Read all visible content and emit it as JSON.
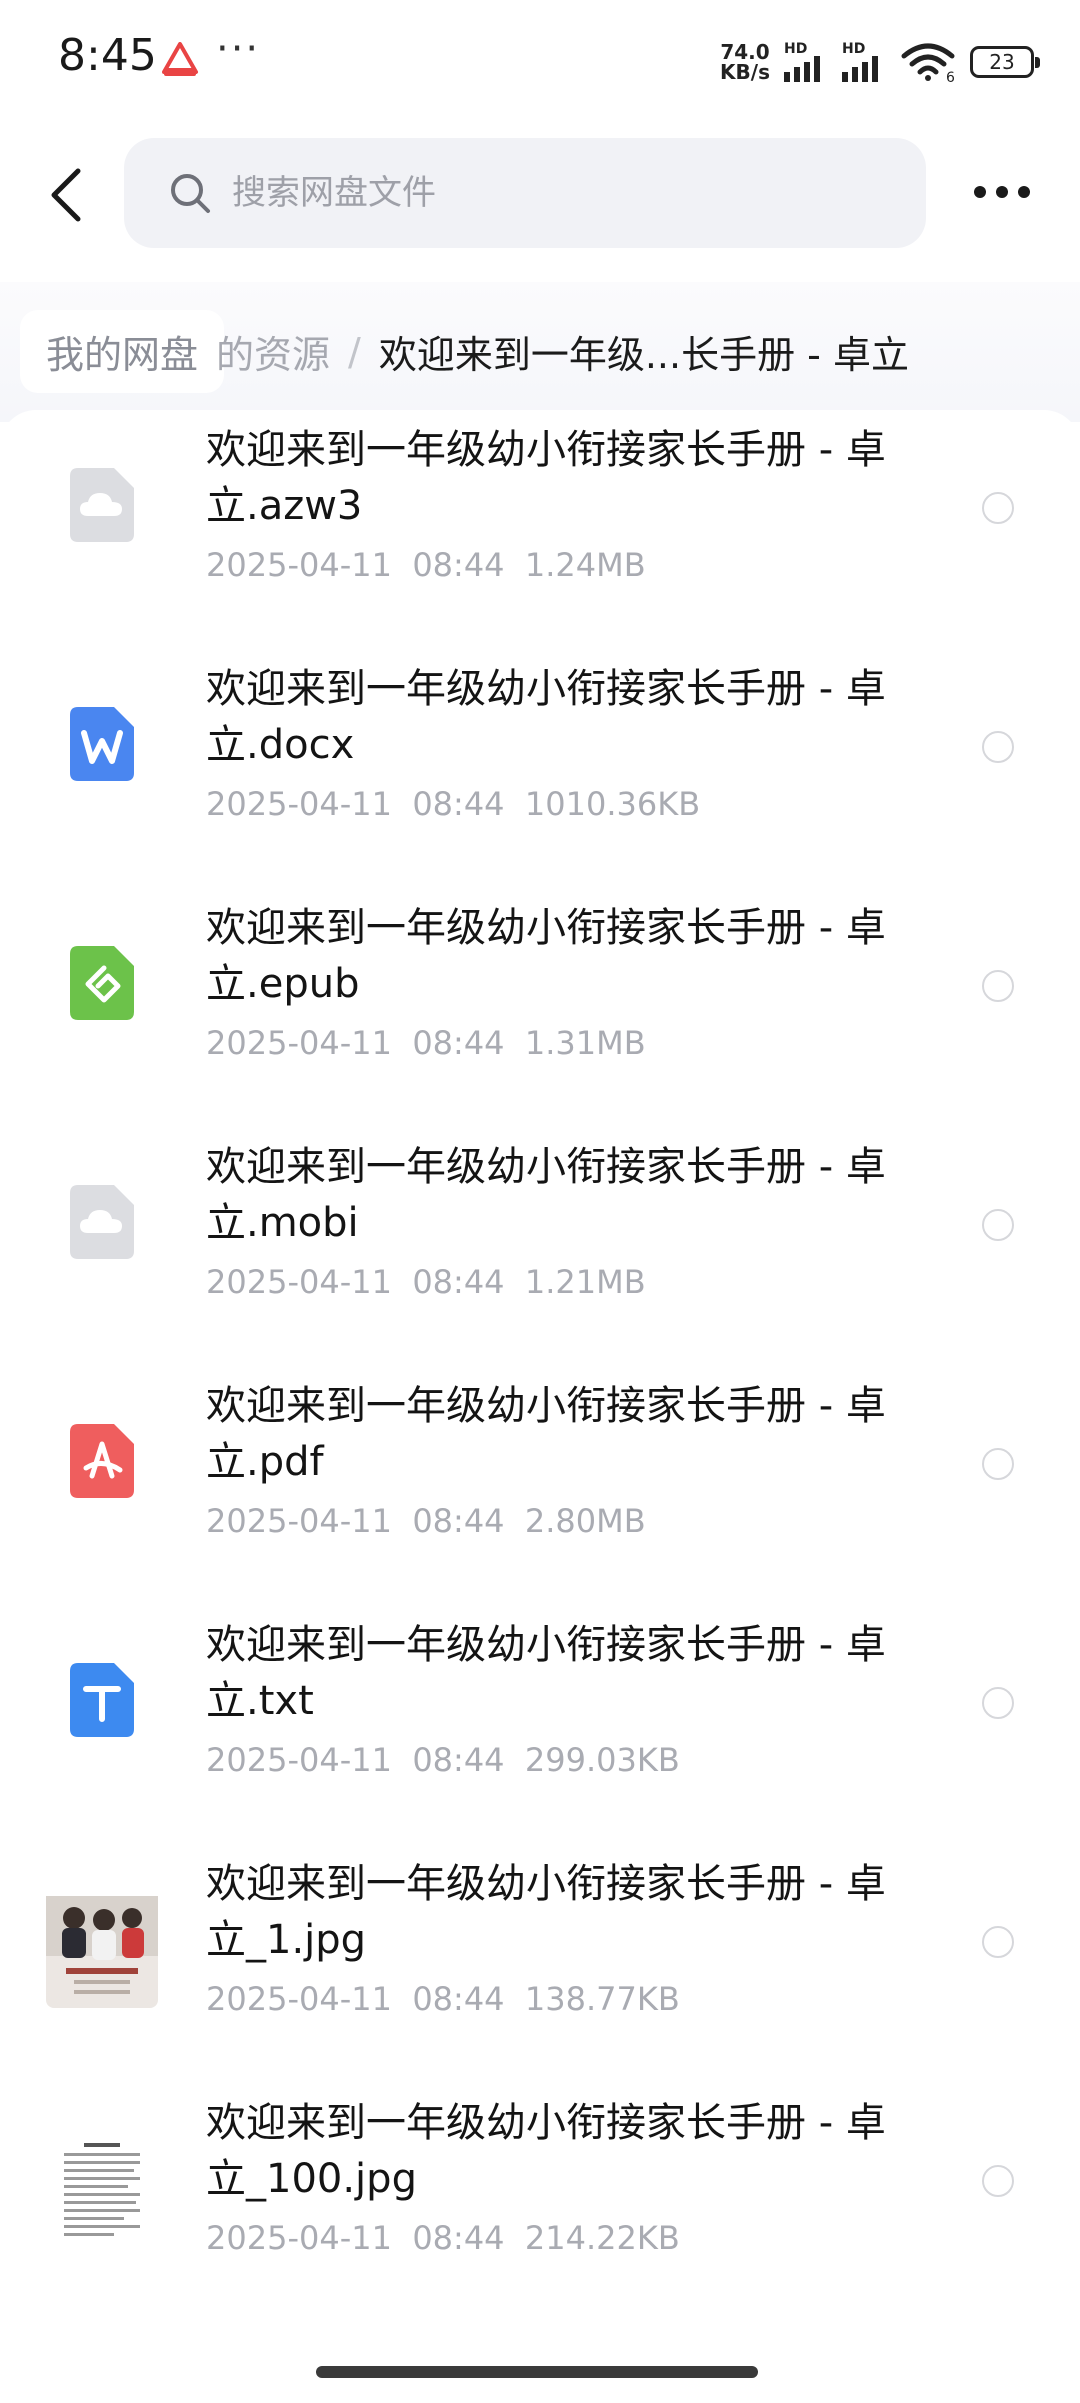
{
  "status_bar": {
    "time": "8:45",
    "dots": "···",
    "net_speed_value": "74.0",
    "net_speed_unit": "KB/s",
    "hd_label_1": "HD",
    "hd_label_2": "HD",
    "wifi_sub": "6",
    "battery": "23"
  },
  "header": {
    "search_placeholder": "搜索网盘文件"
  },
  "breadcrumb": {
    "root": "我的网盘",
    "mid": "的资源",
    "separator": "/",
    "current": "欢迎来到一年级...长手册 - 卓立"
  },
  "files": [
    {
      "line1": "欢迎来到一年级幼小衔接家长手册 - 卓",
      "line2": "立.azw3",
      "meta": "2025-04-11  08:44  1.24MB",
      "icon": "cloud-file-icon"
    },
    {
      "line1": "欢迎来到一年级幼小衔接家长手册 - 卓",
      "line2": "立.docx",
      "meta": "2025-04-11  08:44  1010.36KB",
      "icon": "word-icon"
    },
    {
      "line1": "欢迎来到一年级幼小衔接家长手册 - 卓",
      "line2": "立.epub",
      "meta": "2025-04-11  08:44  1.31MB",
      "icon": "epub-icon"
    },
    {
      "line1": "欢迎来到一年级幼小衔接家长手册 - 卓",
      "line2": "立.mobi",
      "meta": "2025-04-11  08:44  1.21MB",
      "icon": "cloud-file-icon"
    },
    {
      "line1": "欢迎来到一年级幼小衔接家长手册 - 卓",
      "line2": "立.pdf",
      "meta": "2025-04-11  08:44  2.80MB",
      "icon": "pdf-icon"
    },
    {
      "line1": "欢迎来到一年级幼小衔接家长手册 - 卓",
      "line2": "立.txt",
      "meta": "2025-04-11  08:44  299.03KB",
      "icon": "text-icon"
    },
    {
      "line1": "欢迎来到一年级幼小衔接家长手册 - 卓",
      "line2": "立_1.jpg",
      "meta": "2025-04-11  08:44  138.77KB",
      "icon": "image-thumbnail"
    },
    {
      "line1": "欢迎来到一年级幼小衔接家长手册 - 卓",
      "line2": "立_100.jpg",
      "meta": "2025-04-11  08:44  214.22KB",
      "icon": "image-thumbnail"
    }
  ],
  "partial_row_text": "欢迎来到一年级幼小衔接家长手册 - 卓",
  "colors": {
    "word": "#4a86f0",
    "epub": "#6cc24a",
    "pdf": "#ef5e5e",
    "text": "#3d8af0",
    "cloud": "#dcdde1"
  }
}
